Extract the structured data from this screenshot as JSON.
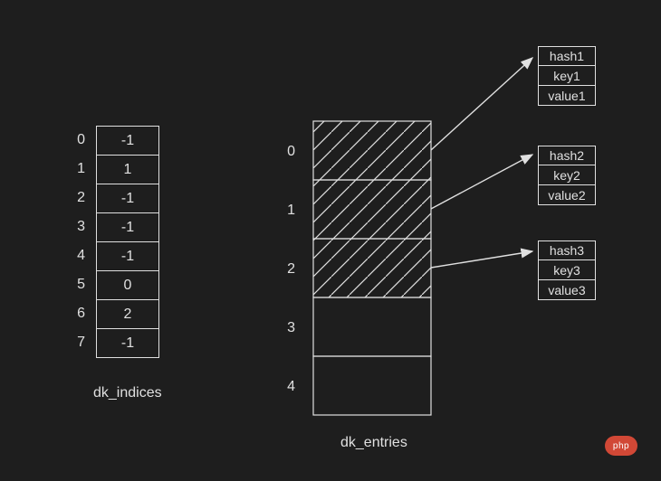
{
  "chart_data": [
    {
      "type": "table",
      "name": "dk_indices",
      "indices": [
        0,
        1,
        2,
        3,
        4,
        5,
        6,
        7
      ],
      "values": [
        -1,
        1,
        -1,
        -1,
        -1,
        0,
        2,
        -1
      ]
    },
    {
      "type": "table",
      "name": "dk_entries",
      "indices": [
        0,
        1,
        2,
        3,
        4
      ],
      "slots": [
        {
          "filled": true,
          "hash": "hash1",
          "key": "key1",
          "value": "value1"
        },
        {
          "filled": true,
          "hash": "hash2",
          "key": "key2",
          "value": "value2"
        },
        {
          "filled": true,
          "hash": "hash3",
          "key": "key3",
          "value": "value3"
        },
        {
          "filled": false
        },
        {
          "filled": false
        }
      ]
    }
  ],
  "labels": {
    "indices_title": "dk_indices",
    "entries_title": "dk_entries"
  },
  "watermark": "php"
}
